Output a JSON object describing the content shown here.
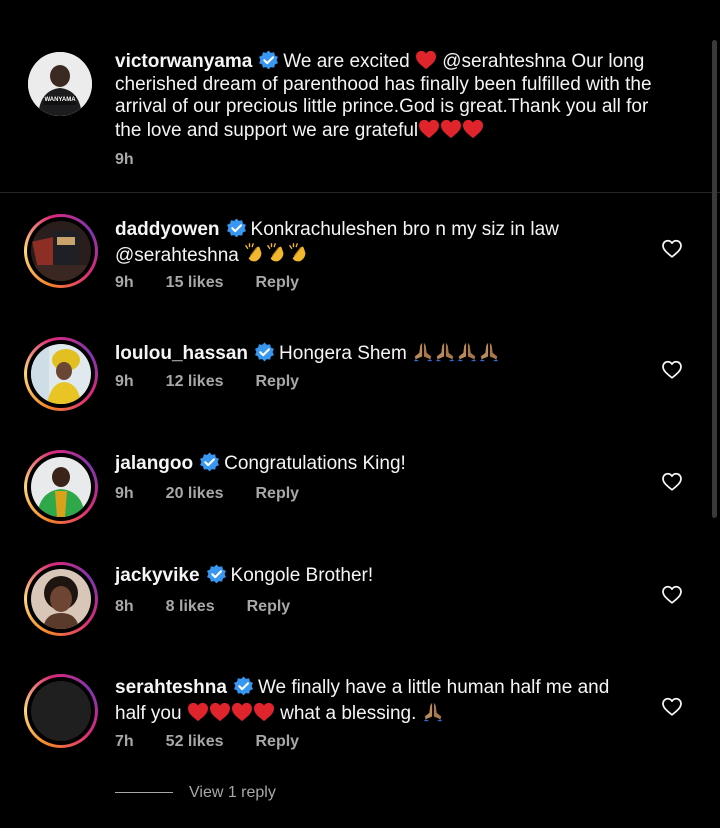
{
  "post": {
    "username": "victorwanyama",
    "text_a": "We are excited",
    "text_b": "@serahteshna Our long cherished dream of parenthood has finally been fulfilled with the arrival of our precious little prince.God is great.Thank you all for the love and support we are grateful",
    "time": "9h",
    "avatar_logo": "WANYAMA"
  },
  "comments": [
    {
      "username": "daddyowen",
      "text": "Konkrachuleshen bro n my siz in law @serahteshna",
      "time": "9h",
      "likes": "15 likes",
      "reply": "Reply"
    },
    {
      "username": "loulou_hassan",
      "text": "Hongera Shem",
      "time": "9h",
      "likes": "12 likes",
      "reply": "Reply"
    },
    {
      "username": "jalangoo",
      "text": "Congratulations King!",
      "time": "9h",
      "likes": "20 likes",
      "reply": "Reply"
    },
    {
      "username": "jackyvike",
      "text": "Kongole Brother!",
      "time": "8h",
      "likes": "8 likes",
      "reply": "Reply"
    },
    {
      "username": "serahteshna",
      "text_a": "We finally have a little human half me and half you",
      "text_b": "what a blessing.",
      "time": "7h",
      "likes": "52 likes",
      "reply": "Reply"
    }
  ],
  "view_replies": "View 1 reply",
  "colors": {
    "background": "#000000",
    "verified": "#3897f0",
    "muted": "#a8a8a8",
    "heart_red": "#e0242c"
  },
  "icons": [
    "verified-badge-icon",
    "heart-outline-icon",
    "red-heart-emoji",
    "clapping-hands-emoji",
    "praying-hands-emoji"
  ]
}
